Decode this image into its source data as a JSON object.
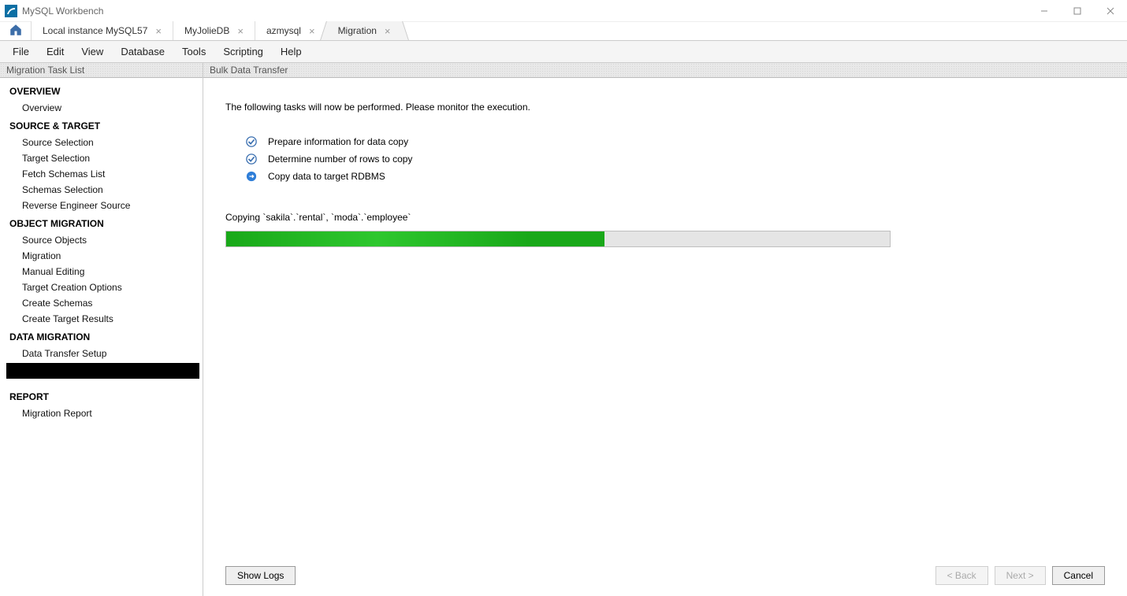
{
  "window": {
    "title": "MySQL Workbench"
  },
  "tabs": [
    {
      "label": "Local instance MySQL57"
    },
    {
      "label": "MyJolieDB"
    },
    {
      "label": "azmysql"
    },
    {
      "label": "Migration"
    }
  ],
  "menu": {
    "file": "File",
    "edit": "Edit",
    "view": "View",
    "database": "Database",
    "tools": "Tools",
    "scripting": "Scripting",
    "help": "Help"
  },
  "sidebar": {
    "header": "Migration Task List",
    "sections": [
      {
        "heading": "OVERVIEW",
        "items": [
          "Overview"
        ]
      },
      {
        "heading": "SOURCE & TARGET",
        "items": [
          "Source Selection",
          "Target Selection",
          "Fetch Schemas List",
          "Schemas Selection",
          "Reverse Engineer Source"
        ]
      },
      {
        "heading": "OBJECT MIGRATION",
        "items": [
          "Source Objects",
          "Migration",
          "Manual Editing",
          "Target Creation Options",
          "Create Schemas",
          "Create Target Results"
        ]
      },
      {
        "heading": "DATA MIGRATION",
        "items": [
          "Data Transfer Setup"
        ]
      },
      {
        "heading": "REPORT",
        "items": [
          "Migration Report"
        ]
      }
    ]
  },
  "main": {
    "header": "Bulk Data Transfer",
    "intro": "The following tasks will now be performed. Please monitor the execution.",
    "steps": [
      {
        "status": "done",
        "label": "Prepare information for data copy"
      },
      {
        "status": "done",
        "label": "Determine number of rows to copy"
      },
      {
        "status": "running",
        "label": "Copy data to target RDBMS"
      }
    ],
    "progress_label": "Copying `sakila`.`rental`, `moda`.`employee`",
    "progress_percent": 57
  },
  "buttons": {
    "show_logs": "Show Logs",
    "back": "< Back",
    "next": "Next >",
    "cancel": "Cancel"
  }
}
